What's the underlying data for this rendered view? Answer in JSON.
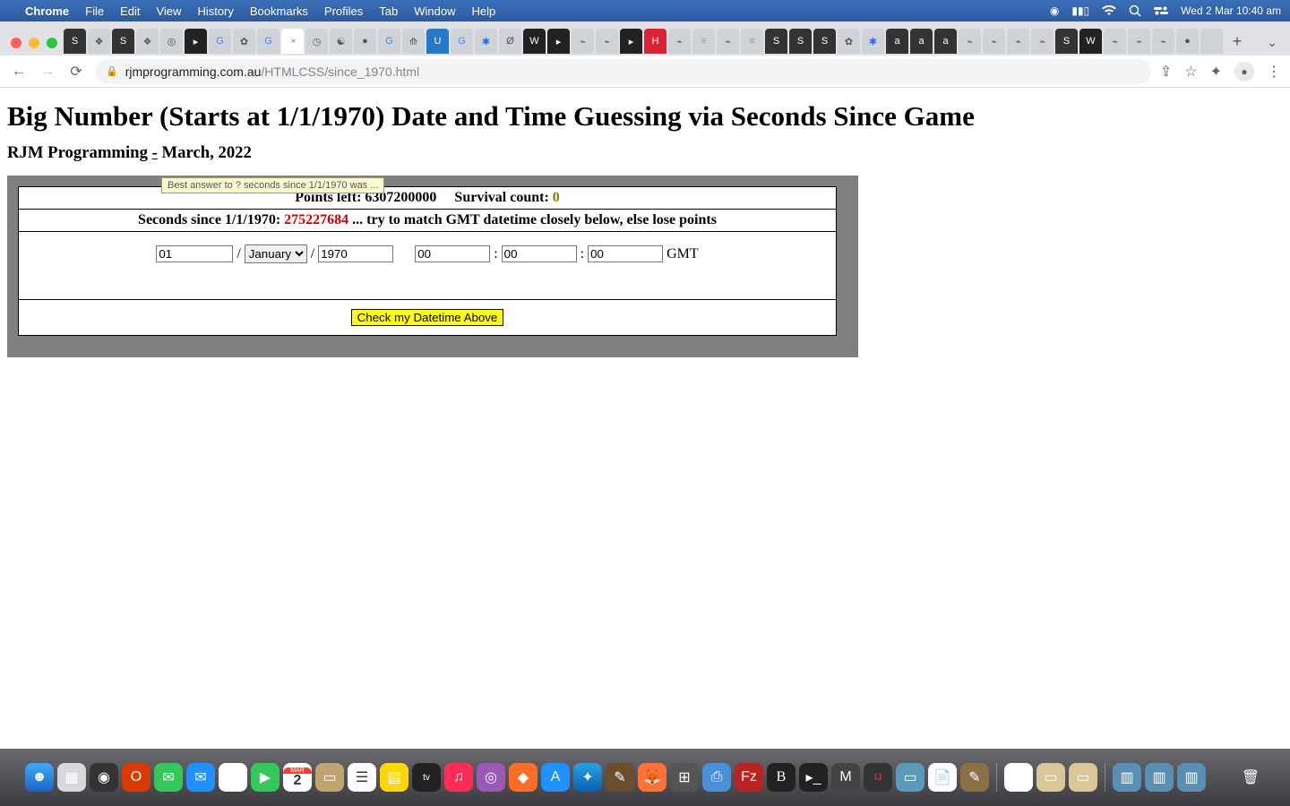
{
  "mac": {
    "app_name": "Chrome",
    "menus": [
      "File",
      "Edit",
      "View",
      "History",
      "Bookmarks",
      "Profiles",
      "Tab",
      "Window",
      "Help"
    ],
    "clock": "Wed 2 Mar  10:40 am"
  },
  "chrome": {
    "url_host": "rjmprogramming.com.au",
    "url_path": "/HTMLCSS/since_1970.html",
    "new_tab": "+",
    "tab_close": "×"
  },
  "page": {
    "title": "Big Number (Starts at 1/1/1970) Date and Time Guessing via Seconds Since Game",
    "subtitle_a": "RJM Programming ",
    "subtitle_dash": "-",
    "subtitle_b": " March, 2022",
    "tooltip": "Best answer to ? seconds since 1/1/1970 was ...",
    "points_label": "Points left: ",
    "points_value": "6307200000",
    "survival_label": "Survival count: ",
    "survival_value": "0",
    "seconds_label": "Seconds since 1/1/1970: ",
    "seconds_value": "275227684",
    "seconds_tail": " ... try to match GMT datetime closely below, else lose points",
    "day_value": "01",
    "month_value": "January",
    "year_value": "1970",
    "hour_value": "00",
    "min_value": "00",
    "sec_value": "00",
    "gmt": " GMT",
    "slash": "/",
    "colon": ":",
    "check_btn": "Check my Datetime Above"
  }
}
